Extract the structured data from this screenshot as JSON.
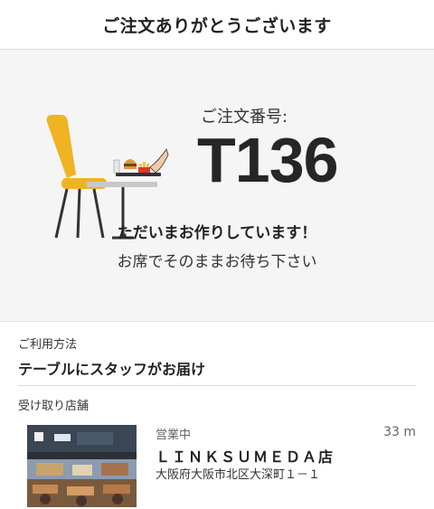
{
  "header": {
    "title": "ご注文ありがとうございます"
  },
  "order": {
    "label": "ご注文番号:",
    "number": "T136",
    "status": "ただいまお作りしています！",
    "message": "お席でそのままお待ち下さい"
  },
  "usage": {
    "label": "ご利用方法",
    "value": "テーブルにスタッフがお届け"
  },
  "store": {
    "section_label": "受け取り店舗",
    "hours_status": "営業中",
    "distance": "33 m",
    "name": "ＬＩＮＫＳＵＭＥＤＡ店",
    "address": "大阪府大阪市北区大深町１－１"
  },
  "colors": {
    "chair": "#f0b323",
    "hero_bg": "#f5f5f5",
    "fries": "#e8332a"
  }
}
